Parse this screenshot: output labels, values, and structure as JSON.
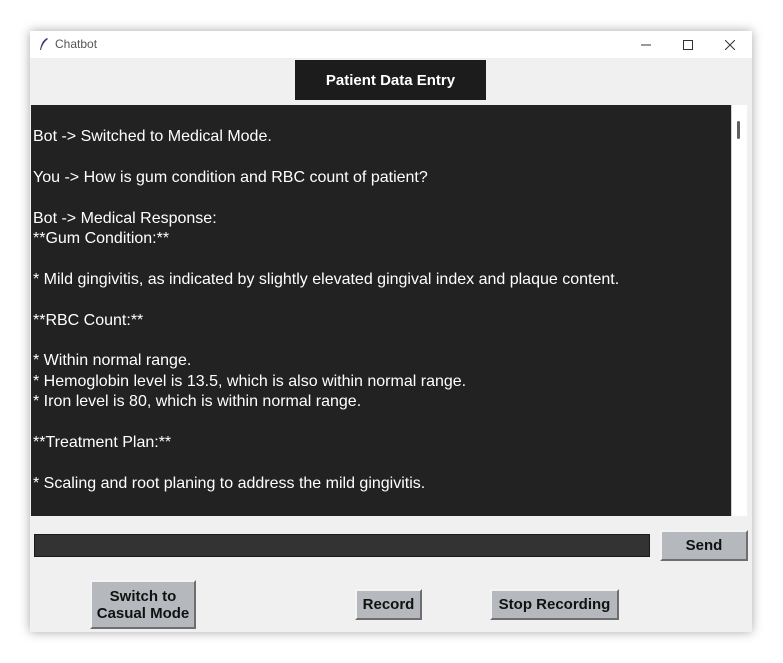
{
  "window": {
    "title": "Chatbot",
    "minimize_icon": "minimize-icon",
    "maximize_icon": "maximize-icon",
    "close_icon": "close-icon"
  },
  "header": {
    "patient_button_label": "Patient Data Entry"
  },
  "chat": {
    "lines": [
      "Bot -> Switched to Medical Mode.",
      "",
      "You -> How is gum condition and RBC count of patient?",
      "",
      "Bot -> Medical Response:",
      "**Gum Condition:**",
      "",
      "* Mild gingivitis, as indicated by slightly elevated gingival index and plaque content.",
      "",
      "**RBC Count:**",
      "",
      "* Within normal range.",
      "* Hemoglobin level is 13.5, which is also within normal range.",
      "* Iron level is 80, which is within normal range.",
      "",
      "**Treatment Plan:**",
      "",
      "* Scaling and root planing to address the mild gingivitis."
    ]
  },
  "input": {
    "value": "",
    "placeholder": ""
  },
  "buttons": {
    "send": "Send",
    "switch_line1": "Switch to",
    "switch_line2": "Casual Mode",
    "record": "Record",
    "stop_recording": "Stop Recording"
  },
  "colors": {
    "chat_background": "#222222",
    "button_face": "#b5b9bd",
    "header_button": "#1c1c1c"
  }
}
